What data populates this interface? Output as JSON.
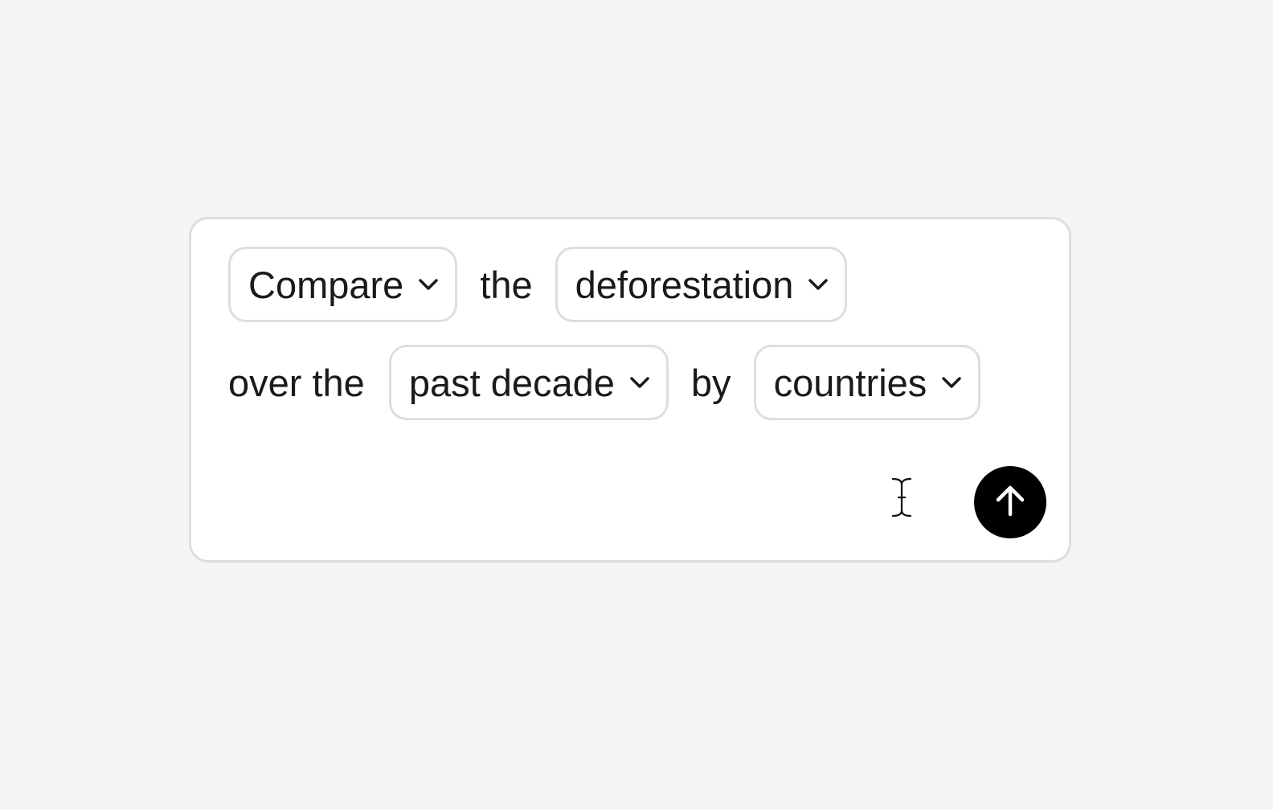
{
  "prompt": {
    "line1": {
      "verb": "Compare",
      "connector": "the",
      "topic": "deforestation"
    },
    "line2": {
      "prefix": "over the",
      "period": "past decade",
      "connector": "by",
      "grouping": "countries"
    }
  },
  "icons": {
    "dropdown": "chevron-down-icon",
    "cursor": "text-cursor-icon",
    "send": "arrow-up-icon"
  },
  "colors": {
    "background": "#f5f5f5",
    "card": "#ffffff",
    "border": "#dedede",
    "text": "#1a1a1a",
    "send_button": "#000000"
  }
}
